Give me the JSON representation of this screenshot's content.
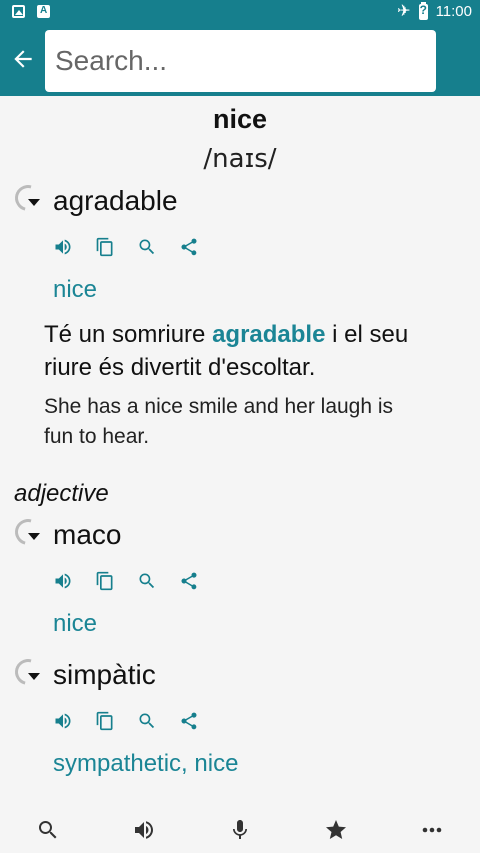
{
  "status_bar": {
    "time": "11:00"
  },
  "search": {
    "placeholder": "Search..."
  },
  "word": {
    "headword": "nice",
    "phonetic": "/naɪs/"
  },
  "entries": [
    {
      "term": "agradable",
      "translation": "nice",
      "example_ca_before": "Té un somriure ",
      "example_ca_highlight": "agradable",
      "example_ca_after": " i el seu riure és divertit d'escoltar.",
      "example_en": "She has a nice smile and her laugh is fun to hear."
    },
    {
      "term": "maco",
      "translation": "nice"
    },
    {
      "term": "simpàtic",
      "translation": "sympathetic, nice"
    }
  ],
  "part_of_speech": "adjective",
  "colors": {
    "primary": "#167f8d",
    "link": "#1b8595",
    "background": "#f5f5f5"
  },
  "icons": {
    "entry_actions": [
      "speaker-icon",
      "copy-icon",
      "search-icon",
      "share-icon"
    ],
    "bottom_nav": [
      "search-icon",
      "speaker-icon",
      "microphone-icon",
      "star-icon",
      "more-icon"
    ]
  }
}
